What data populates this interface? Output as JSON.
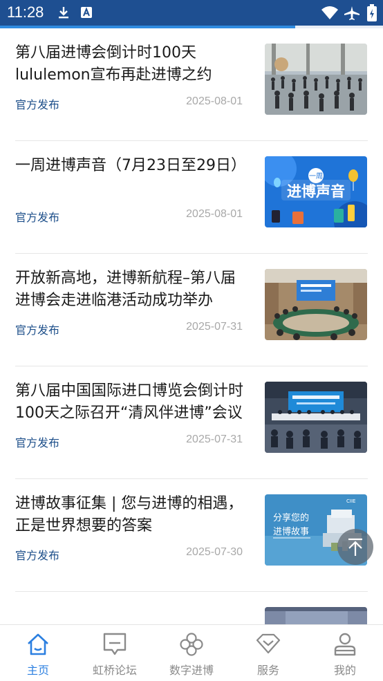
{
  "status_bar": {
    "time": "11:28",
    "icons": [
      "download-icon",
      "app-a-icon",
      "wifi-icon",
      "airplane-icon",
      "battery-icon"
    ]
  },
  "progress": {
    "value": 0.77,
    "color": "#2f8be0"
  },
  "articles": [
    {
      "title": "第八届进博会倒计时100天 lululemon宣布再赴进博之约",
      "source": "官方发布",
      "date": "2025-08-01",
      "thumb": "photo-yoga-event"
    },
    {
      "title": "一周进博声音（7月23日至29日）",
      "source": "官方发布",
      "date": "2025-08-01",
      "thumb": "banner-weekly-voice"
    },
    {
      "title": "开放新高地，进博新航程–第八届进博会走进临港活动成功举办",
      "source": "官方发布",
      "date": "2025-07-31",
      "thumb": "photo-conference-room"
    },
    {
      "title": "第八届中国国际进口博览会倒计时100天之际召开“清风伴进博”会议",
      "source": "官方发布",
      "date": "2025-07-31",
      "thumb": "photo-meeting-hall"
    },
    {
      "title": "进博故事征集 | 您与进博的相遇，正是世界想要的答案",
      "source": "官方发布",
      "date": "2025-07-30",
      "thumb": "banner-share-story"
    }
  ],
  "thumb_text": {
    "weekly_small": "一周",
    "weekly_big": "进博声音",
    "share_line1": "分享您的",
    "share_line2": "进博故事",
    "share_logo": "CIIE"
  },
  "tabs": [
    {
      "label": "主页",
      "icon": "home-icon",
      "active": true
    },
    {
      "label": "虹桥论坛",
      "icon": "forum-icon",
      "active": false
    },
    {
      "label": "数字进博",
      "icon": "clover-icon",
      "active": false
    },
    {
      "label": "服务",
      "icon": "diamond-icon",
      "active": false
    },
    {
      "label": "我的",
      "icon": "profile-icon",
      "active": false
    }
  ],
  "colors": {
    "status_bar": "#1e4f91",
    "accent": "#2b7fe0",
    "source_text": "#1d4f8a",
    "inactive": "#8a8a8a"
  }
}
